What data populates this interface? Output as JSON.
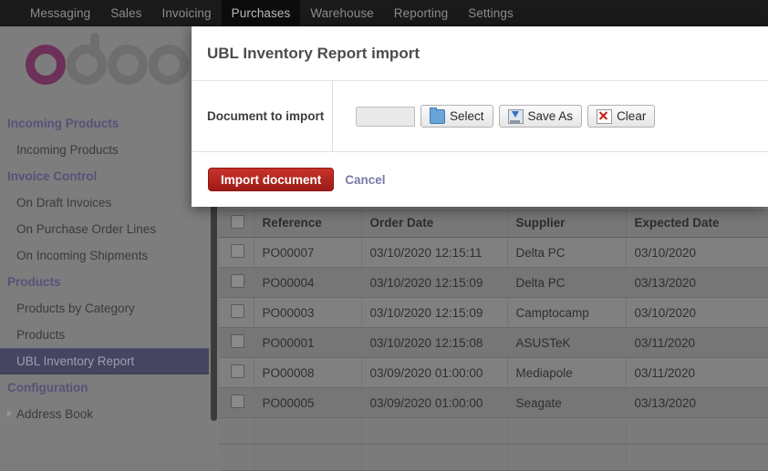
{
  "topbar": {
    "items": [
      {
        "label": "Messaging",
        "active": false
      },
      {
        "label": "Sales",
        "active": false
      },
      {
        "label": "Invoicing",
        "active": false
      },
      {
        "label": "Purchases",
        "active": true
      },
      {
        "label": "Warehouse",
        "active": false
      },
      {
        "label": "Reporting",
        "active": false
      },
      {
        "label": "Settings",
        "active": false
      }
    ]
  },
  "brand": {
    "name": "odoo",
    "accent_color": "#6d3058",
    "muted_color": "#6e6e6e"
  },
  "sidebar": {
    "entries": [
      {
        "type": "section",
        "label": "Incoming Products"
      },
      {
        "type": "item",
        "label": "Incoming Products",
        "selected": false
      },
      {
        "type": "section",
        "label": "Invoice Control"
      },
      {
        "type": "item",
        "label": "On Draft Invoices",
        "selected": false
      },
      {
        "type": "item",
        "label": "On Purchase Order Lines",
        "selected": false
      },
      {
        "type": "item",
        "label": "On Incoming Shipments",
        "selected": false
      },
      {
        "type": "section",
        "label": "Products"
      },
      {
        "type": "item",
        "label": "Products by Category",
        "selected": false
      },
      {
        "type": "item",
        "label": "Products",
        "selected": false
      },
      {
        "type": "item",
        "label": "UBL Inventory Report",
        "selected": true
      },
      {
        "type": "section",
        "label": "Configuration"
      },
      {
        "type": "toggle",
        "label": "Address Book",
        "selected": false
      }
    ]
  },
  "dialog": {
    "title": "UBL Inventory Report import",
    "field_label": "Document to import",
    "file_value": "",
    "buttons": [
      {
        "label": "Select",
        "icon": "folder-icon"
      },
      {
        "label": "Save As",
        "icon": "save-icon"
      },
      {
        "label": "Clear",
        "icon": "clear-icon"
      }
    ],
    "primary_action": "Import document",
    "secondary_action": "Cancel",
    "primary_color": "#b32820"
  },
  "list": {
    "columns": [
      "Reference",
      "Order Date",
      "Supplier",
      "Expected Date"
    ],
    "rows": [
      {
        "reference": "PO00007",
        "order_date": "03/10/2020 12:15:11",
        "supplier": "Delta PC",
        "expected_date": "03/10/2020"
      },
      {
        "reference": "PO00004",
        "order_date": "03/10/2020 12:15:09",
        "supplier": "Delta PC",
        "expected_date": "03/13/2020"
      },
      {
        "reference": "PO00003",
        "order_date": "03/10/2020 12:15:09",
        "supplier": "Camptocamp",
        "expected_date": "03/10/2020"
      },
      {
        "reference": "PO00001",
        "order_date": "03/10/2020 12:15:08",
        "supplier": "ASUSTeK",
        "expected_date": "03/11/2020"
      },
      {
        "reference": "PO00008",
        "order_date": "03/09/2020 01:00:00",
        "supplier": "Mediapole",
        "expected_date": "03/11/2020"
      },
      {
        "reference": "PO00005",
        "order_date": "03/09/2020 01:00:00",
        "supplier": "Seagate",
        "expected_date": "03/13/2020"
      }
    ]
  }
}
